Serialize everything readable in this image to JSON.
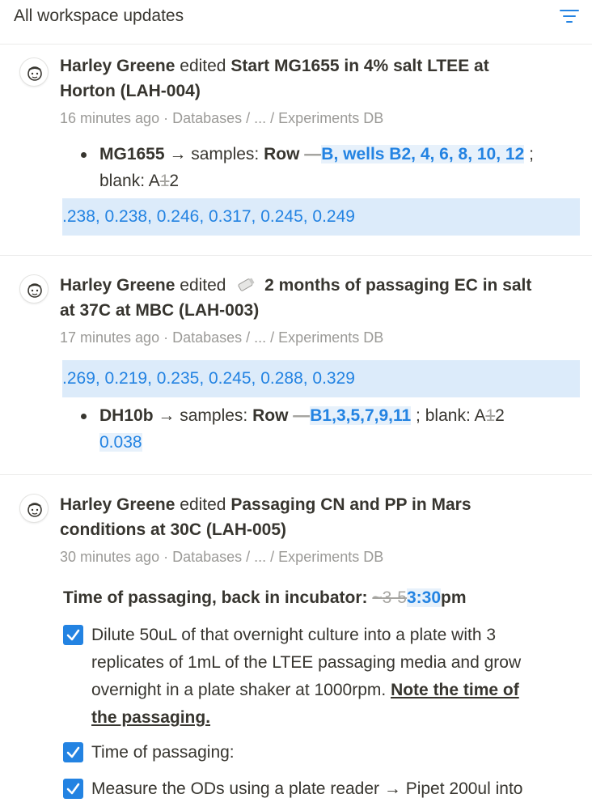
{
  "header": {
    "title": "All workspace updates",
    "filter_icon": "filter-lines-icon"
  },
  "updates": [
    {
      "user": "Harley Greene",
      "action": "edited",
      "page_title_line1": "Start MG1655 in 4% salt LTEE at",
      "page_title_line2": "Horton (LAH-004)",
      "time": "16 minutes ago",
      "path": "Databases / ... / Experiments DB",
      "bullet": {
        "strain": "MG1655",
        "arrow": "→",
        "samples_label": "samples:",
        "row_label": "Row",
        "deleted": "—",
        "added": "B, wells B2, 4, 6, 8, 10, 12",
        "semicolon": ";",
        "blank_prefix": "blank: A",
        "blank_deleted": "1",
        "blank_suffix": "2"
      },
      "values_block": ".238, 0.238, 0.246, 0.317, 0.245, 0.249"
    },
    {
      "user": "Harley Greene",
      "action": "edited",
      "page_icon": "salt-shaker-icon",
      "page_title_line1": "2 months of passaging EC in salt",
      "page_title_line2": "at 37C at MBC (LAH-003)",
      "time": "17 minutes ago",
      "path": "Databases / ... / Experiments DB",
      "values_block": ".269, 0.219, 0.235, 0.245, 0.288, 0.329",
      "bullet": {
        "strain": "DH10b",
        "arrow": "→",
        "samples_label": "samples:",
        "row_label": "Row",
        "deleted": "—",
        "added": "B1,3,5,7,9,11",
        "semicolon": ";",
        "blank_prefix": "blank: A",
        "blank_deleted": "1",
        "blank_suffix": "2",
        "extra_line": "0.038"
      }
    },
    {
      "user": "Harley Greene",
      "action": "edited",
      "page_title_line1": "Passaging CN and PP in Mars",
      "page_title_line2": "conditions at 30C (LAH-005)",
      "time": "30 minutes ago",
      "path": "Databases / ... / Experiments DB",
      "time_line": {
        "label": "Time of passaging, back in incubator:",
        "deleted": "~3-5",
        "added": "3:30",
        "suffix": "pm"
      },
      "checklist": [
        {
          "checked": true,
          "line1": "Dilute 50uL of that overnight culture into a plate with 3",
          "line2": "replicates of 1mL of the LTEE passaging media and grow",
          "line3": "overnight in a plate shaker at 1000rpm.",
          "note1": "Note the time of",
          "note2": "the passaging."
        },
        {
          "checked": true,
          "line1": "Time of passaging:"
        },
        {
          "checked": true,
          "line1": "Measure the ODs using a plate reader → Pipet 200ul into"
        }
      ]
    }
  ],
  "colors": {
    "accent": "#2383e2",
    "highlight": "#dcebfa",
    "muted": "#9b9a97",
    "text": "#37352f"
  }
}
